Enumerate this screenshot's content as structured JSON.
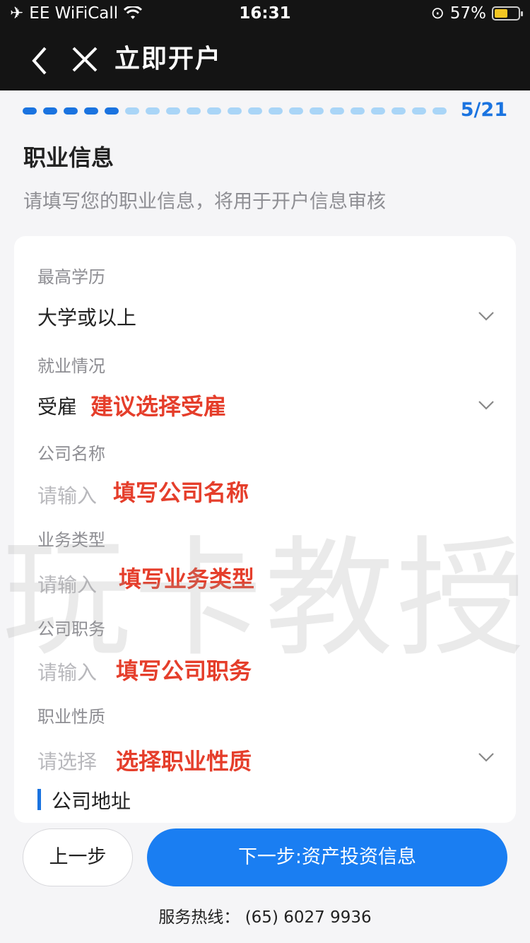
{
  "status_bar": {
    "carrier": "EE WiFiCall",
    "time": "16:31",
    "battery": "57%"
  },
  "nav": {
    "title": "立即开户"
  },
  "progress": {
    "current": 5,
    "total": 21,
    "label": "5/21"
  },
  "section": {
    "title": "职业信息",
    "subtitle": "请填写您的职业信息，将用于开户信息审核"
  },
  "form": {
    "education": {
      "label": "最高学历",
      "value": "大学或以上"
    },
    "employment": {
      "label": "就业情况",
      "value": "受雇",
      "note": "建议选择受雇"
    },
    "company": {
      "label": "公司名称",
      "placeholder": "请输入",
      "note": "填写公司名称"
    },
    "business": {
      "label": "业务类型",
      "placeholder": "请输入",
      "note": "填写业务类型"
    },
    "position": {
      "label": "公司职务",
      "placeholder": "请输入",
      "note": "填写公司职务"
    },
    "nature": {
      "label": "职业性质",
      "placeholder": "请选择",
      "note": "选择职业性质"
    },
    "address_heading": "公司地址"
  },
  "watermark": "玩卡教授",
  "buttons": {
    "prev": "上一步",
    "next": "下一步:资产投资信息"
  },
  "hotline": "服务热线：  (65) 6027 9936",
  "colors": {
    "accent": "#1a73e0",
    "annotation": "#e53e2b"
  }
}
